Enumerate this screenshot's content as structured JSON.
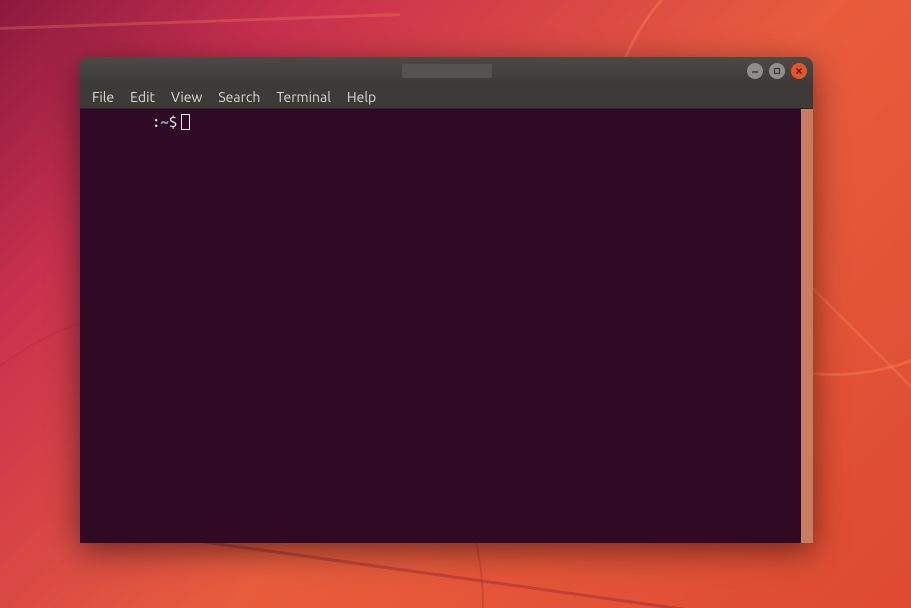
{
  "window": {
    "title": ""
  },
  "menubar": {
    "items": [
      {
        "label": "File"
      },
      {
        "label": "Edit"
      },
      {
        "label": "View"
      },
      {
        "label": "Search"
      },
      {
        "label": "Terminal"
      },
      {
        "label": "Help"
      }
    ]
  },
  "prompt": {
    "colon": ":",
    "path": "~",
    "dollar": "$"
  }
}
